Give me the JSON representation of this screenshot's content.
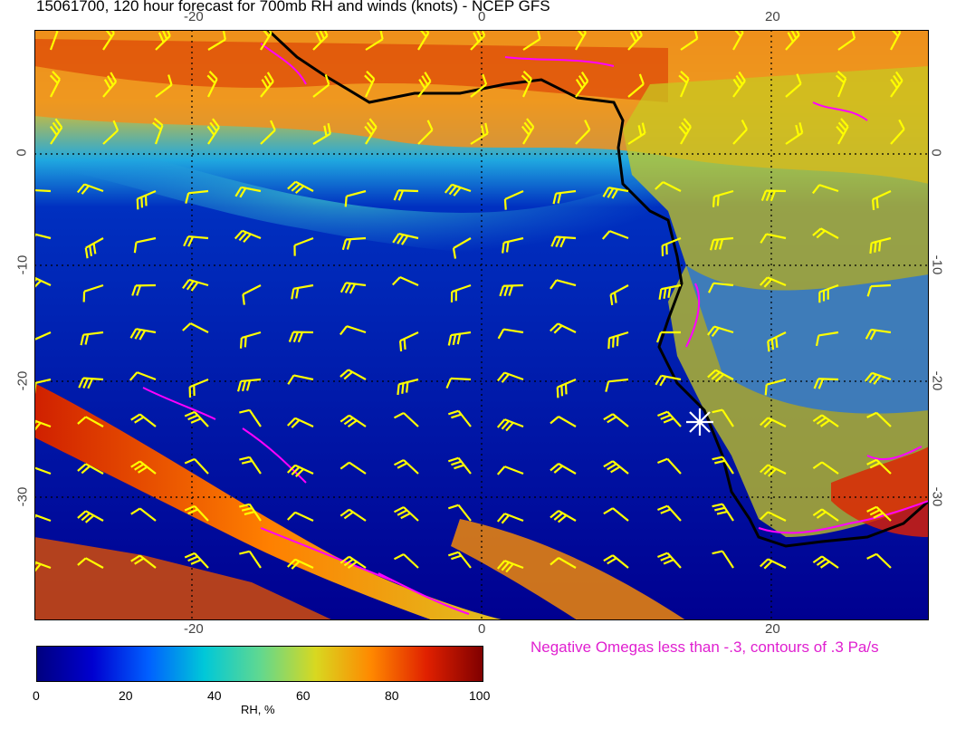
{
  "title": "15061700, 120 hour forecast for 700mb RH and winds (knots) - NCEP GFS",
  "axes": {
    "lon_ticks_top": [
      "-20",
      "0",
      "20"
    ],
    "lon_ticks_bottom": [
      "-20",
      "0",
      "20"
    ],
    "lat_ticks_left": [
      "0",
      "-10",
      "-20",
      "-30"
    ],
    "lat_ticks_right": [
      "0",
      "-10",
      "-20",
      "-30"
    ]
  },
  "colorbar": {
    "labels": [
      "0",
      "20",
      "40",
      "60",
      "80",
      "100"
    ],
    "title": "RH, %",
    "colors": [
      "#000080",
      "#0000d0",
      "#0060ff",
      "#00c8d8",
      "#60d890",
      "#d8d820",
      "#ff8800",
      "#e02000",
      "#800000"
    ]
  },
  "omega_note": "Negative Omegas less than -.3, contours of .3 Pa/s",
  "colors": {
    "wind_barbs": "#ffff00",
    "omega_contours": "#ff00ff",
    "coastline": "#000000",
    "grid": "#000000",
    "marker": "#ffffff"
  }
}
